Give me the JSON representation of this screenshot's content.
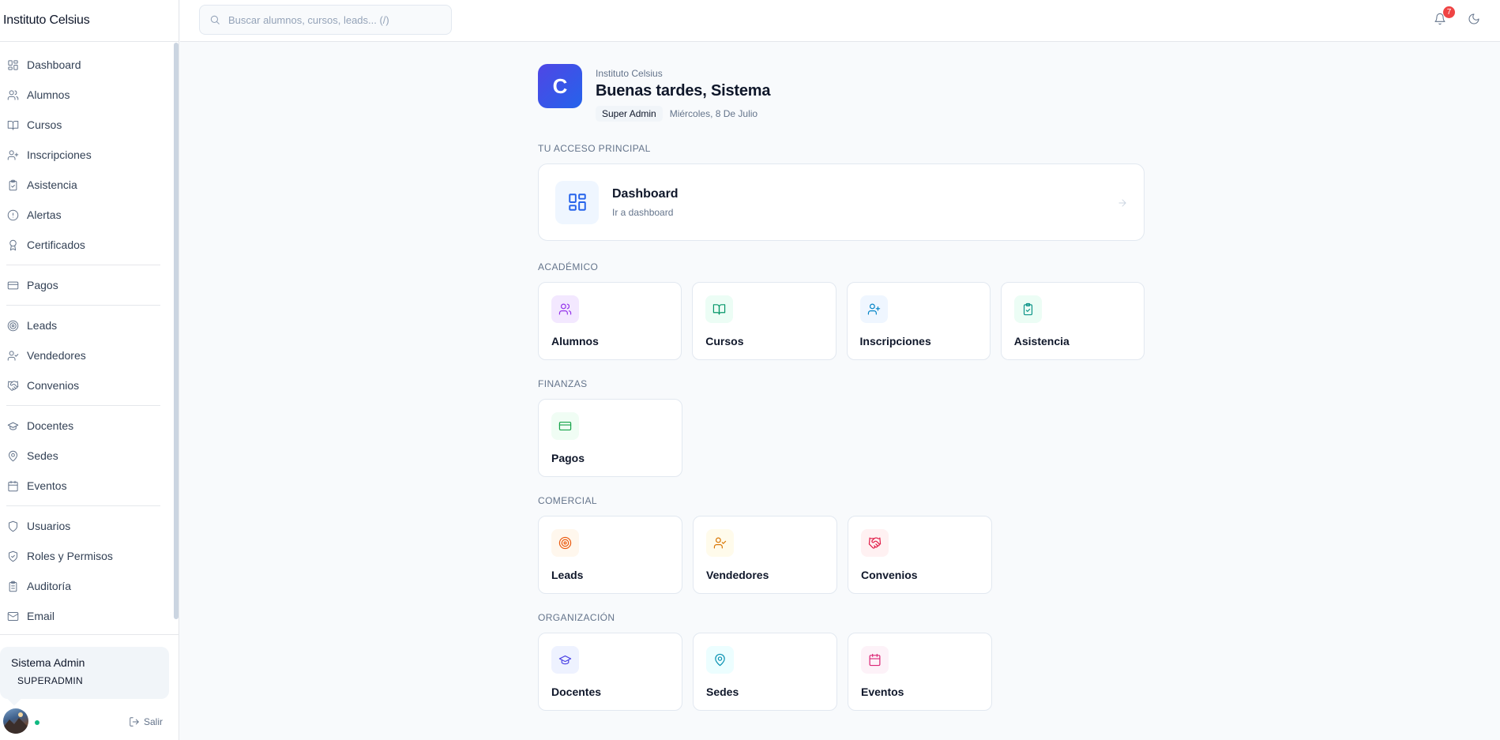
{
  "brand": "Instituto Celsius",
  "search": {
    "placeholder": "Buscar alumnos, cursos, leads... (/)"
  },
  "notifications": {
    "count": "7"
  },
  "sidebar": {
    "groups": [
      [
        {
          "label": "Dashboard",
          "icon": "dashboard-icon"
        },
        {
          "label": "Alumnos",
          "icon": "users-icon"
        },
        {
          "label": "Cursos",
          "icon": "book-icon"
        },
        {
          "label": "Inscripciones",
          "icon": "user-plus-icon"
        },
        {
          "label": "Asistencia",
          "icon": "clipboard-check-icon"
        },
        {
          "label": "Alertas",
          "icon": "alert-circle-icon"
        },
        {
          "label": "Certificados",
          "icon": "award-icon"
        }
      ],
      [
        {
          "label": "Pagos",
          "icon": "credit-card-icon"
        }
      ],
      [
        {
          "label": "Leads",
          "icon": "target-icon"
        },
        {
          "label": "Vendedores",
          "icon": "user-check-icon"
        },
        {
          "label": "Convenios",
          "icon": "handshake-icon"
        }
      ],
      [
        {
          "label": "Docentes",
          "icon": "graduation-cap-icon"
        },
        {
          "label": "Sedes",
          "icon": "map-pin-icon"
        },
        {
          "label": "Eventos",
          "icon": "calendar-icon"
        }
      ],
      [
        {
          "label": "Usuarios",
          "icon": "shield-icon"
        },
        {
          "label": "Roles y Permisos",
          "icon": "shield-check-icon"
        },
        {
          "label": "Auditoría",
          "icon": "clipboard-list-icon"
        },
        {
          "label": "Email",
          "icon": "mail-icon"
        }
      ]
    ]
  },
  "user": {
    "name": "Sistema Admin",
    "role": "SUPERADMIN",
    "logout": "Salir"
  },
  "header": {
    "logo_letter": "C",
    "org": "Instituto Celsius",
    "greeting": "Buenas tardes, Sistema",
    "role": "Super Admin",
    "date": "Miércoles, 8 De Julio"
  },
  "primary": {
    "section": "TU ACCESO PRINCIPAL",
    "title": "Dashboard",
    "subtitle": "Ir a dashboard"
  },
  "sections": [
    {
      "title": "ACADÉMICO",
      "tiles": [
        {
          "label": "Alumnos",
          "icon": "users-icon",
          "bg": "#f3e8ff",
          "color": "#9333ea"
        },
        {
          "label": "Cursos",
          "icon": "book-icon",
          "bg": "#ecfdf5",
          "color": "#059669"
        },
        {
          "label": "Inscripciones",
          "icon": "user-plus-icon",
          "bg": "#eff6ff",
          "color": "#0284c7"
        },
        {
          "label": "Asistencia",
          "icon": "clipboard-check-icon",
          "bg": "#ecfdf5",
          "color": "#0d9488"
        }
      ]
    },
    {
      "title": "FINANZAS",
      "tiles": [
        {
          "label": "Pagos",
          "icon": "credit-card-icon",
          "bg": "#f0fdf4",
          "color": "#16a34a"
        }
      ]
    },
    {
      "title": "COMERCIAL",
      "tiles": [
        {
          "label": "Leads",
          "icon": "target-icon",
          "bg": "#fff7ed",
          "color": "#ea580c"
        },
        {
          "label": "Vendedores",
          "icon": "user-check-icon",
          "bg": "#fffbeb",
          "color": "#d97706"
        },
        {
          "label": "Convenios",
          "icon": "handshake-icon",
          "bg": "#fff1f2",
          "color": "#e11d48"
        }
      ]
    },
    {
      "title": "ORGANIZACIÓN",
      "tiles": [
        {
          "label": "Docentes",
          "icon": "graduation-cap-icon",
          "bg": "#eef2ff",
          "color": "#4f46e5"
        },
        {
          "label": "Sedes",
          "icon": "map-pin-icon",
          "bg": "#ecfeff",
          "color": "#0891b2"
        },
        {
          "label": "Eventos",
          "icon": "calendar-icon",
          "bg": "#fdf2f8",
          "color": "#db2777"
        }
      ]
    }
  ]
}
